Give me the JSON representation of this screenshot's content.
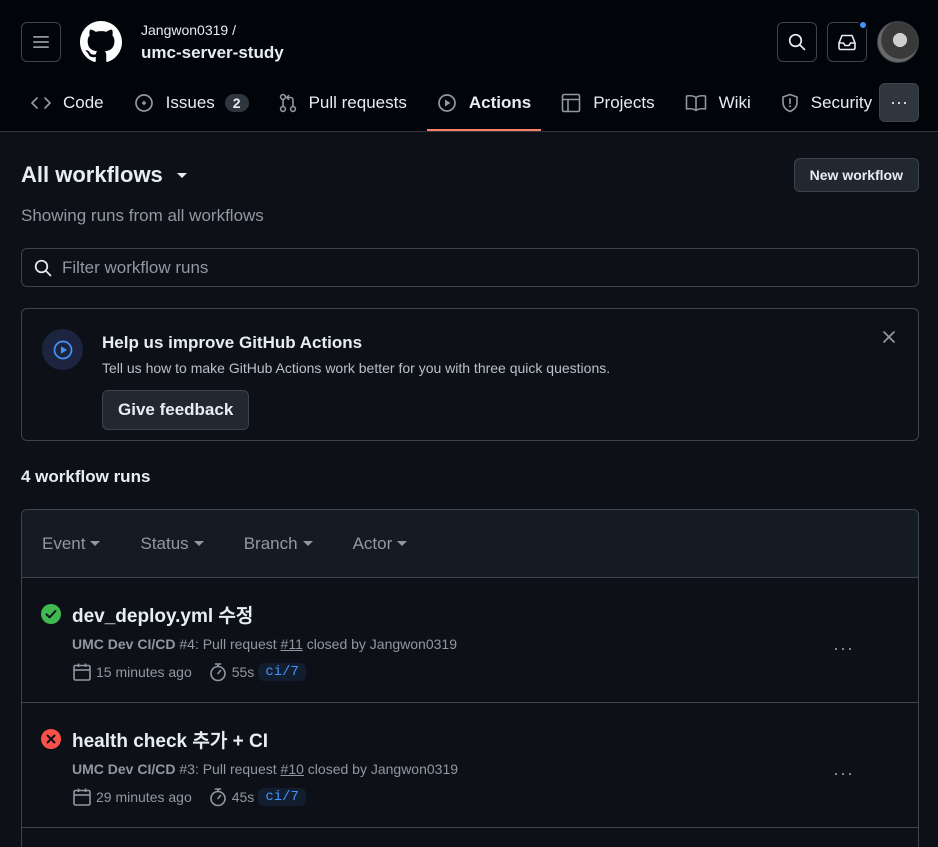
{
  "header": {
    "owner": "Jangwon0319 /",
    "repo": "umc-server-study"
  },
  "tabs": [
    {
      "label": "Code",
      "icon": "code-icon"
    },
    {
      "label": "Issues",
      "icon": "issue-opened-icon",
      "count": "2"
    },
    {
      "label": "Pull requests",
      "icon": "git-pull-request-icon"
    },
    {
      "label": "Actions",
      "icon": "play-icon",
      "active": true
    },
    {
      "label": "Projects",
      "icon": "table-icon"
    },
    {
      "label": "Wiki",
      "icon": "book-icon"
    },
    {
      "label": "Security",
      "icon": "shield-icon"
    }
  ],
  "more_tabs": "···",
  "page": {
    "title": "All workflows",
    "subtitle": "Showing runs from all workflows",
    "new_workflow": "New workflow",
    "filter_placeholder": "Filter workflow runs"
  },
  "banner": {
    "title": "Help us improve GitHub Actions",
    "text": "Tell us how to make GitHub Actions work better for you with three quick questions.",
    "button": "Give feedback"
  },
  "runs_count": "4 workflow runs",
  "filters": [
    "Event",
    "Status",
    "Branch",
    "Actor"
  ],
  "runs": [
    {
      "status": "success",
      "title": "dev_deploy.yml 수정",
      "workflow": "UMC Dev CI/CD",
      "run_number": "#4",
      "event_prefix": ": Pull request ",
      "pr": "#11",
      "event_suffix": " closed by Jangwon0319",
      "time": "15 minutes ago",
      "duration": "55s",
      "branch": "ci/7"
    },
    {
      "status": "failure",
      "title": "health check 추가 + CI",
      "workflow": "UMC Dev CI/CD",
      "run_number": "#3",
      "event_prefix": ": Pull request ",
      "pr": "#10",
      "event_suffix": " closed by Jangwon0319",
      "time": "29 minutes ago",
      "duration": "45s",
      "branch": "ci/7"
    }
  ],
  "run_more": "···",
  "colors": {
    "accent": "#f78166",
    "success": "#3fb950",
    "failure": "#f85149",
    "link": "#4493f8"
  }
}
